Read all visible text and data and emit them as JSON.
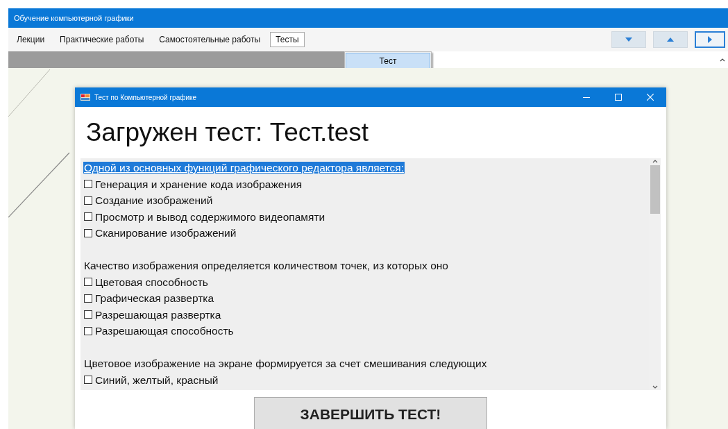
{
  "window": {
    "title": "Обучение компьютерной графики"
  },
  "menu": [
    {
      "label": "Лекции",
      "selected": false
    },
    {
      "label": "Практические работы",
      "selected": false
    },
    {
      "label": "Самостоятельные работы",
      "selected": false
    },
    {
      "label": "Тесты",
      "selected": true
    }
  ],
  "dropdown": [
    {
      "label": "Тест",
      "selected": true
    }
  ],
  "nav_buttons": [
    {
      "kind": "down",
      "focused": false
    },
    {
      "kind": "up",
      "focused": false
    },
    {
      "kind": "right",
      "focused": true
    }
  ],
  "dialog": {
    "title": "Тест по Компьютерной графике",
    "heading": "Загружен тест: Тест.test",
    "questions": [
      {
        "text": "Одной из основных функций графического редактора является:",
        "selected": true,
        "options": [
          {
            "label": "Генерация и хранение кода изображения",
            "checked": false
          },
          {
            "label": "Создание изображений",
            "checked": false
          },
          {
            "label": "Просмотр и вывод содержимого видеопамяти",
            "checked": false
          },
          {
            "label": "Сканирование изображений",
            "checked": false
          }
        ]
      },
      {
        "text": "Качество изображения определяется количеством точек, из которых оно",
        "selected": false,
        "options": [
          {
            "label": "Цветовая способность",
            "checked": false
          },
          {
            "label": "Графическая развертка",
            "checked": false
          },
          {
            "label": "Разрешающая развертка",
            "checked": false
          },
          {
            "label": "Разрешающая способность",
            "checked": false
          }
        ]
      },
      {
        "text": "Цветовое изображение на экране формируется за счет смешивания следующих",
        "selected": false,
        "options": [
          {
            "label": "Синий, желтый, красный",
            "checked": false
          }
        ]
      }
    ],
    "finish_button": "ЗАВЕРШИТЬ ТЕСТ!"
  }
}
